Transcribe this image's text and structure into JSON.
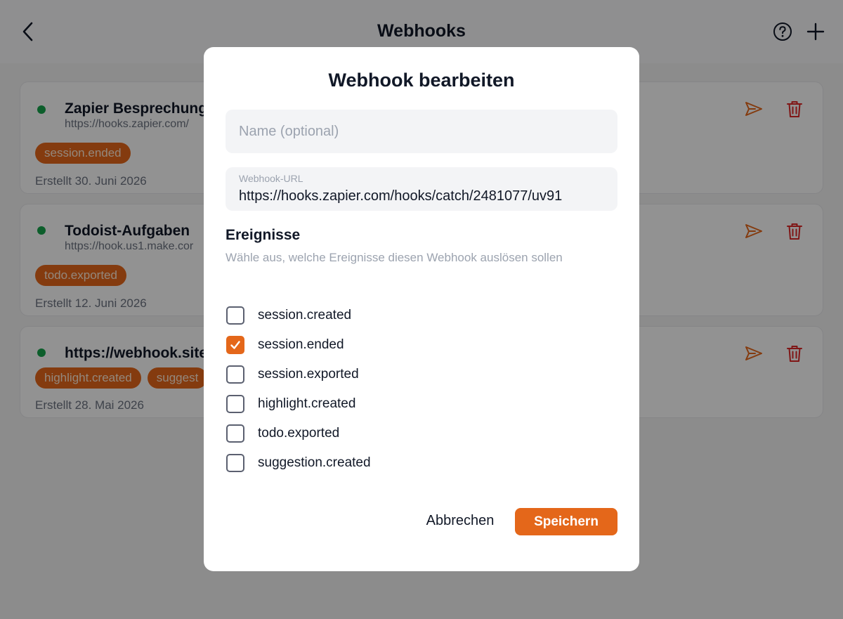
{
  "header": {
    "title": "Webhooks"
  },
  "webhooks": [
    {
      "name": "Zapier Besprechungs",
      "url": "https://hooks.zapier.com/",
      "tags": [
        "session.ended"
      ],
      "created": "Erstellt 30. Juni 2026",
      "status_color": "#16a34a"
    },
    {
      "name": "Todoist-Aufgaben",
      "url": "https://hook.us1.make.cor",
      "tags": [
        "todo.exported"
      ],
      "created": "Erstellt 12. Juni 2026",
      "status_color": "#16a34a"
    },
    {
      "name": "https://webhook.site",
      "url": "",
      "tags": [
        "highlight.created",
        "suggest"
      ],
      "created": "Erstellt 28. Mai 2026",
      "status_color": "#16a34a"
    }
  ],
  "modal": {
    "title": "Webhook bearbeiten",
    "name_placeholder": "Name (optional)",
    "name_value": "",
    "url_label": "Webhook-URL",
    "url_value": "https://hooks.zapier.com/hooks/catch/2481077/uv91",
    "events_title": "Ereignisse",
    "events_description": "Wähle aus, welche Ereignisse diesen Webhook auslösen sollen",
    "events": [
      {
        "label": "session.created",
        "checked": false
      },
      {
        "label": "session.ended",
        "checked": true
      },
      {
        "label": "session.exported",
        "checked": false
      },
      {
        "label": "highlight.created",
        "checked": false
      },
      {
        "label": "todo.exported",
        "checked": false
      },
      {
        "label": "suggestion.created",
        "checked": false
      }
    ],
    "cancel_label": "Abbrechen",
    "save_label": "Speichern"
  },
  "colors": {
    "accent": "#e4671a",
    "status_active": "#16a34a",
    "delete": "#dc2626"
  },
  "icons": {
    "back": "chevron-left-icon",
    "help": "question-circle-icon",
    "add": "plus-icon",
    "send": "paper-plane-icon",
    "delete": "trash-icon",
    "check": "checkmark-icon"
  }
}
